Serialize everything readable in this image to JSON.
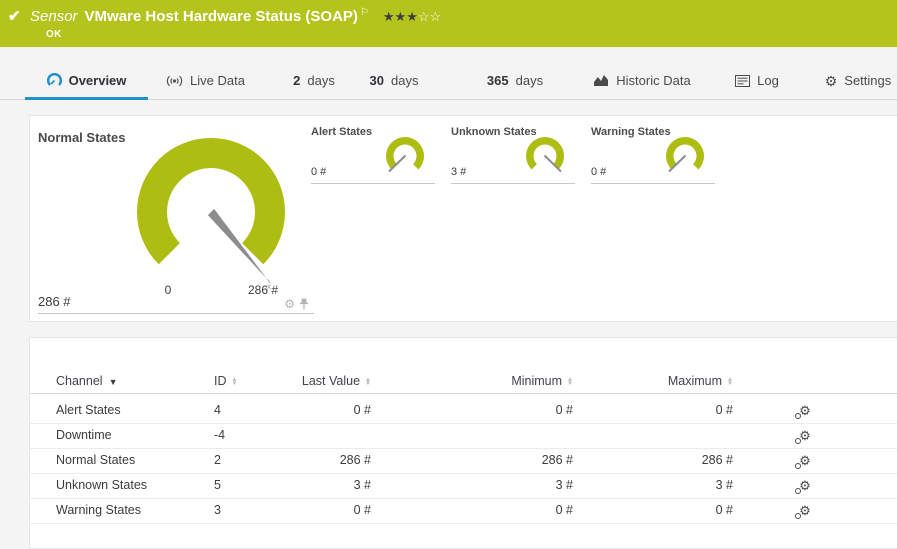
{
  "header": {
    "type_label": "Sensor",
    "title": "VMware Host Hardware Status (SOAP)",
    "status": "OK",
    "rating": "3 of 5 stars",
    "bar_color": "#b5c31d"
  },
  "icons": {
    "check": "✔",
    "flag": "⚐",
    "gear": "⚙",
    "stars_filled": "★★★",
    "stars_empty": "☆☆",
    "sort_up": "▲",
    "sort_down": "▼",
    "caret_down": "▼"
  },
  "tabs": {
    "active": "Overview",
    "items": [
      {
        "label": "Overview"
      },
      {
        "label": "Live Data"
      },
      {
        "num": "2",
        "unit": "days"
      },
      {
        "num": "30",
        "unit": "days"
      },
      {
        "num": "365",
        "unit": "days"
      },
      {
        "label": "Historic Data"
      },
      {
        "label": "Log"
      },
      {
        "label": "Settings"
      }
    ]
  },
  "gauges": {
    "accent_color": "#aebd12",
    "main": {
      "title": "Normal States",
      "value": "286 #",
      "scale_min": "0",
      "scale_max": "286 #",
      "marker": "x"
    },
    "small": [
      {
        "title": "Alert States",
        "value": "0 #",
        "needle": "min"
      },
      {
        "title": "Unknown States",
        "value": "3 #",
        "needle": "max"
      },
      {
        "title": "Warning States",
        "value": "0 #",
        "needle": "min"
      }
    ]
  },
  "table": {
    "columns": {
      "channel": "Channel",
      "id": "ID",
      "last": "Last Value",
      "min": "Minimum",
      "max": "Maximum"
    },
    "rows": [
      {
        "channel": "Alert States",
        "id": "4",
        "last": "0 #",
        "min": "0 #",
        "max": "0 #"
      },
      {
        "channel": "Downtime",
        "id": "-4",
        "last": "",
        "min": "",
        "max": ""
      },
      {
        "channel": "Normal States",
        "id": "2",
        "last": "286 #",
        "min": "286 #",
        "max": "286 #"
      },
      {
        "channel": "Unknown States",
        "id": "5",
        "last": "3 #",
        "min": "3 #",
        "max": "3 #"
      },
      {
        "channel": "Warning States",
        "id": "3",
        "last": "0 #",
        "min": "0 #",
        "max": "0 #"
      }
    ]
  }
}
